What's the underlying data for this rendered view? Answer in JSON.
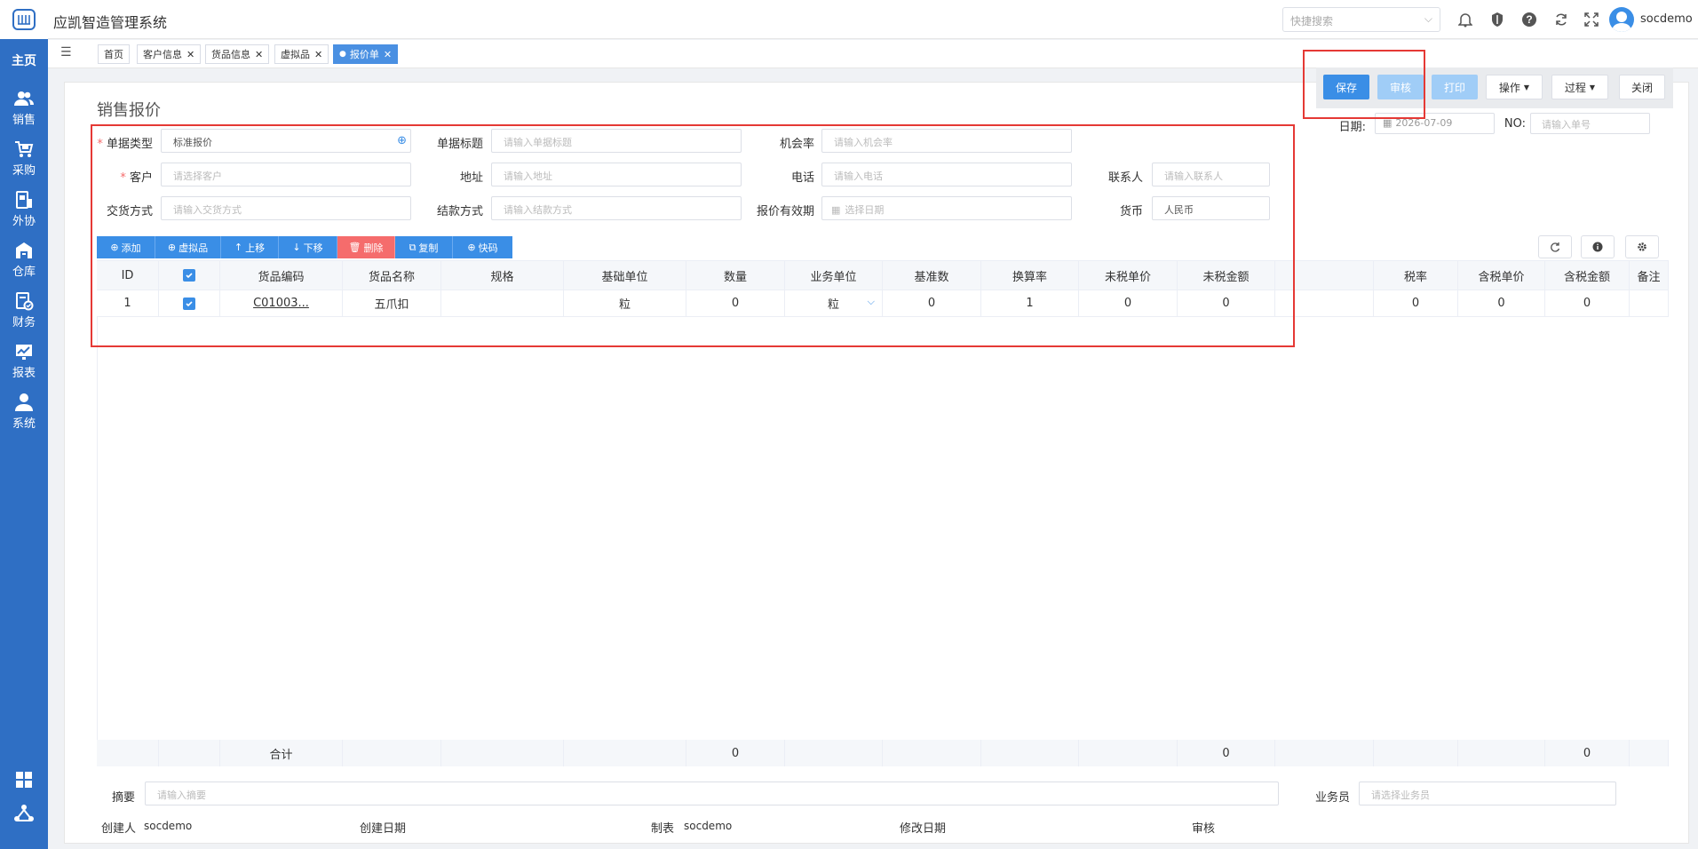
{
  "app": {
    "title": "应凯智造管理系统",
    "user": "socdemo",
    "search_placeholder": "快捷搜索"
  },
  "sidebar": {
    "home": "主页",
    "items": [
      {
        "label": "销售",
        "icon": "users-icon"
      },
      {
        "label": "采购",
        "icon": "cart-icon"
      },
      {
        "label": "外协",
        "icon": "outsource-icon"
      },
      {
        "label": "仓库",
        "icon": "warehouse-icon"
      },
      {
        "label": "财务",
        "icon": "finance-icon"
      },
      {
        "label": "报表",
        "icon": "chart-icon"
      },
      {
        "label": "系统",
        "icon": "person-icon"
      }
    ]
  },
  "tabs": [
    {
      "label": "首页"
    },
    {
      "label": "客户信息"
    },
    {
      "label": "货品信息"
    },
    {
      "label": "虚拟品"
    },
    {
      "label": "报价单"
    }
  ],
  "toolbar": {
    "save": "保存",
    "audit": "审核",
    "print": "打印",
    "operate": "操作",
    "process": "过程",
    "close": "关闭"
  },
  "page": {
    "title": "销售报价"
  },
  "header_fields": {
    "date_label": "日期:",
    "date_value": "2026-07-09",
    "no_label": "NO:",
    "no_placeholder": "请输入单号",
    "doc_type_label": "单据类型",
    "doc_type_value": "标准报价",
    "doc_title_label": "单据标题",
    "doc_title_placeholder": "请输入单据标题",
    "chance_label": "机会率",
    "chance_placeholder": "请输入机会率",
    "customer_label": "客户",
    "customer_placeholder": "请选择客户",
    "address_label": "地址",
    "address_placeholder": "请输入地址",
    "phone_label": "电话",
    "phone_placeholder": "请输入电话",
    "contact_label": "联系人",
    "contact_placeholder": "请输入联系人",
    "delivery_label": "交货方式",
    "delivery_placeholder": "请输入交货方式",
    "settle_label": "结款方式",
    "settle_placeholder": "请输入结款方式",
    "valid_label": "报价有效期",
    "valid_placeholder": "选择日期",
    "currency_label": "货币",
    "currency_value": "人民币"
  },
  "row_buttons": {
    "add": "添加",
    "virtual": "虚拟品",
    "up": "上移",
    "down": "下移",
    "delete": "删除",
    "copy": "复制",
    "quick": "快码"
  },
  "table": {
    "headers": [
      "ID",
      "",
      "货品编码",
      "货品名称",
      "规格",
      "基础单位",
      "数量",
      "业务单位",
      "基准数",
      "换算率",
      "未税单价",
      "未税金额",
      "",
      "税率",
      "含税单价",
      "含税金额",
      "备注"
    ],
    "row": {
      "id": "1",
      "code": "C01003...",
      "name": "五爪扣",
      "spec": "",
      "base_unit": "粒",
      "qty": "0",
      "biz_unit": "粒",
      "base_num": "0",
      "ratio": "1",
      "price_notax": "0",
      "amount_notax": "0",
      "tax_rate": "0",
      "price_tax": "0",
      "amount_tax": "0",
      "remark": ""
    },
    "footer": {
      "label": "合计",
      "qty": "0",
      "amount_notax": "0",
      "amount_tax": "0"
    }
  },
  "bottom": {
    "summary_label": "摘要",
    "summary_placeholder": "请输入摘要",
    "salesman_label": "业务员",
    "salesman_placeholder": "请选择业务员",
    "creator_label": "创建人",
    "creator_value": "socdemo",
    "created_date_label": "创建日期",
    "maker_label": "制表",
    "maker_value": "socdemo",
    "modified_date_label": "修改日期",
    "auditor_label": "审核"
  }
}
